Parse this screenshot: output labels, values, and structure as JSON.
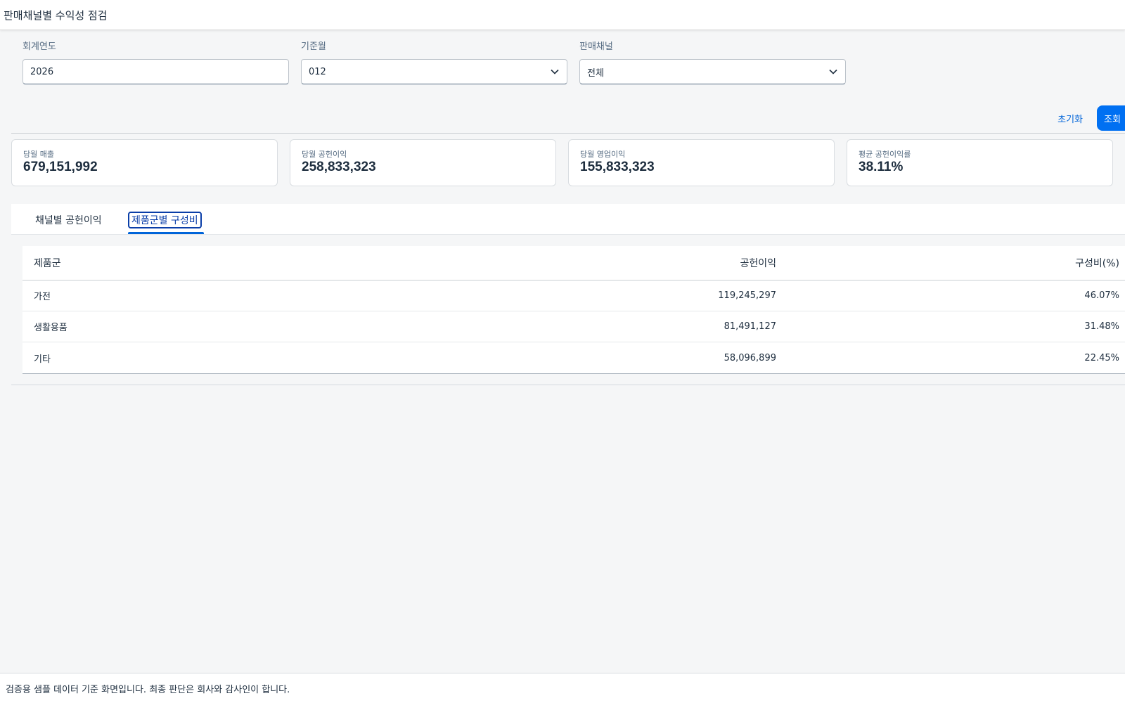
{
  "header": {
    "title": "판매채널별 수익성 점검"
  },
  "filters": [
    {
      "label": "회계연도",
      "value": "2026",
      "type": "input"
    },
    {
      "label": "기준월",
      "value": "012",
      "type": "select"
    },
    {
      "label": "판매채널",
      "value": "전체",
      "type": "select"
    }
  ],
  "toolbar": {
    "reset_label": "초기화",
    "search_label": "조회"
  },
  "kpis": [
    {
      "label": "당월 매출",
      "value": "679,151,992"
    },
    {
      "label": "당월 공헌이익",
      "value": "258,833,323"
    },
    {
      "label": "당월 영업이익",
      "value": "155,833,323"
    },
    {
      "label": "평균 공헌이익률",
      "value": "38.11%"
    }
  ],
  "tabs": [
    {
      "label": "채널별 공헌이익",
      "selected": false
    },
    {
      "label": "제품군별 구성비",
      "selected": true
    }
  ],
  "table": {
    "columns": [
      "제품군",
      "공헌이익",
      "구성비(%)"
    ],
    "rows": [
      [
        "가전",
        "119,245,297",
        "46.07%"
      ],
      [
        "생활용품",
        "81,491,127",
        "31.48%"
      ],
      [
        "기타",
        "58,096,899",
        "22.45%"
      ]
    ]
  },
  "footer": {
    "text": "검증용 샘플 데이터 기준 화면입니다. 최종 판단은 회사와 감사인이 합니다."
  },
  "colors": {
    "accent": "#0070f2",
    "link": "#0064d9",
    "background": "#f5f6f7"
  },
  "icons": {
    "select_icon": "chevron-down-icon"
  }
}
